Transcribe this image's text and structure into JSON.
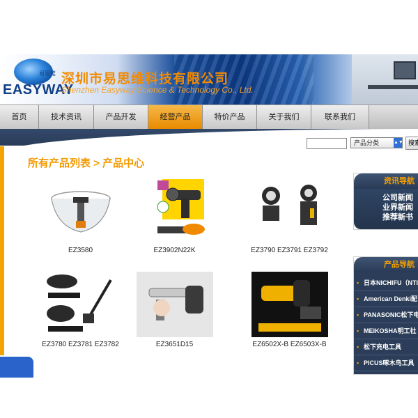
{
  "header": {
    "logo_text": "EASYWAY",
    "logo_small_cn": "易思维",
    "company_cn": "深圳市易思维科技有限公司",
    "company_en": "Shenzhen Easyway Science & Technology Co., Ltd."
  },
  "nav": {
    "items": [
      {
        "label": "首页"
      },
      {
        "label": "技术资讯"
      },
      {
        "label": "产品开发"
      },
      {
        "label": "经营产品"
      },
      {
        "label": "特价产品"
      },
      {
        "label": "关于我们"
      },
      {
        "label": "联系我们"
      }
    ],
    "active_index": 3,
    "active_color": "#f0a020"
  },
  "search": {
    "category_selected": "产品分类",
    "button_label": "搜索"
  },
  "main": {
    "title": "所有产品列表 > 产品中心",
    "products": [
      {
        "name": "EZ3580"
      },
      {
        "name": "EZ3902N22K"
      },
      {
        "name": "EZ3790 EZ3791 EZ3792"
      },
      {
        "name": "EZ3780 EZ3781 EZ3782"
      },
      {
        "name": "EZ3651D15"
      },
      {
        "name": "EZ6502X-B EZ6503X-B"
      }
    ]
  },
  "sidebar": {
    "news_title": "资讯导航",
    "news_items": [
      "公司新闻",
      "业界新闻",
      "推荐新书"
    ],
    "product_title": "产品导航",
    "product_items": [
      "日本NICHIFU（NTI",
      "American Denki配",
      "PANASONIC松下电",
      "MEIKOSHA明工社",
      "松下充电工具",
      "PICUS啄木鸟工具"
    ]
  },
  "colors": {
    "accent_orange": "#f39a00",
    "sidebar_navy": "#2b3d58",
    "logo_blue": "#123e86"
  }
}
